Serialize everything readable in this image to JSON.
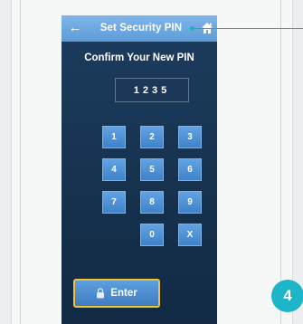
{
  "header": {
    "title": "Set Security PIN",
    "back_icon": "arrow-left-icon",
    "home_icon": "home-icon"
  },
  "subtitle": "Confirm Your New PIN",
  "pin_value": "1235",
  "keypad": {
    "k1": "1",
    "k2": "2",
    "k3": "3",
    "k4": "4",
    "k5": "5",
    "k6": "6",
    "k7": "7",
    "k8": "8",
    "k9": "9",
    "k0": "0",
    "kx": "X"
  },
  "enter_label": "Enter",
  "step_number": "4",
  "colors": {
    "header": "#6fa9e2",
    "screen": "#1a3655",
    "key": "#4f90d6",
    "enter_border": "#f1c232",
    "callout": "#1ab0c2"
  }
}
